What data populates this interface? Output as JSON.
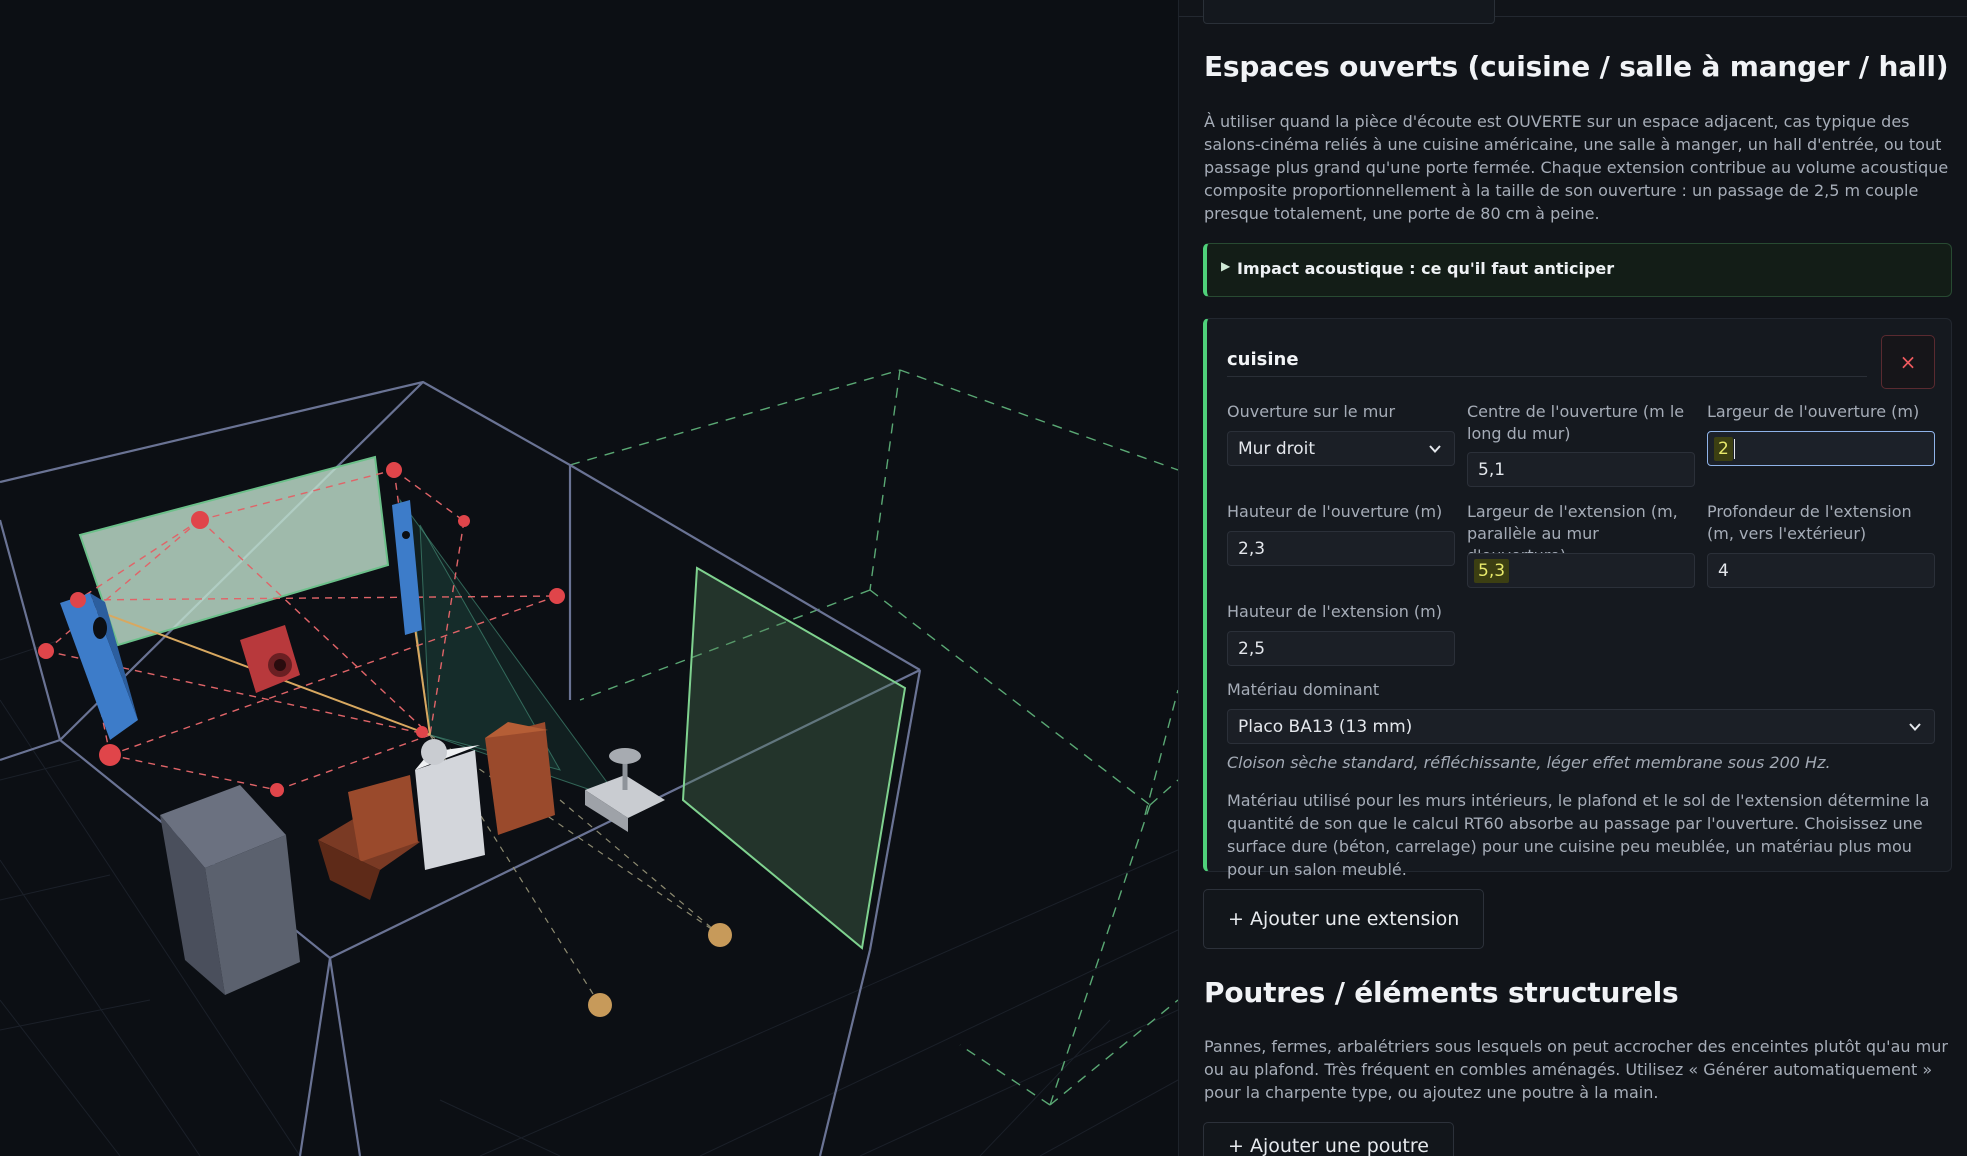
{
  "sections": {
    "open_spaces": {
      "title": "Espaces ouverts (cuisine / salle à manger / hall)",
      "description": "À utiliser quand la pièce d'écoute est OUVERTE sur un espace adjacent, cas typique des salons-cinéma reliés à une cuisine américaine, une salle à manger, un hall d'entrée, ou tout passage plus grand qu'une porte fermée. Chaque extension contribue au volume acoustique composite proportionnellement à la taille de son ouverture : un passage de 2,5 m couple presque totalement, une porte de 80 cm à peine.",
      "details_label": "Impact acoustique : ce qu'il faut anticiper",
      "add_extension_label": "+ Ajouter une extension"
    },
    "beams": {
      "title": "Poutres / éléments structurels",
      "description": "Pannes, fermes, arbalétriers sous lesquels on peut accrocher des enceintes plutôt qu'au mur ou au plafond. Très fréquent en combles aménagés. Utilisez « Générer automatiquement » pour la charpente type, ou ajoutez une poutre à la main.",
      "add_beam_label": "+ Ajouter une poutre"
    }
  },
  "extension": {
    "name": "cuisine",
    "remove_label": "×",
    "wall_label": "Ouverture sur le mur",
    "wall_value": "Mur droit",
    "center_label": "Centre de l'ouverture (m le long du mur)",
    "center_value": "5,1",
    "opening_width_label": "Largeur de l'ouverture (m)",
    "opening_width_value": "2",
    "opening_height_label": "Hauteur de l'ouverture (m)",
    "opening_height_value": "2,3",
    "ext_width_label": "Largeur de l'extension (m, parallèle au mur d'ouverture)",
    "ext_width_value": "5,3",
    "ext_depth_label": "Profondeur de l'extension (m, vers l'extérieur)",
    "ext_depth_value": "4",
    "ext_height_label": "Hauteur de l'extension (m)",
    "ext_height_value": "2,5",
    "material_label": "Matériau dominant",
    "material_value": "Placo BA13 (13 mm)",
    "material_note": "Cloison sèche standard, réfléchissante, léger effet membrane sous 200 Hz.",
    "material_help": "Matériau utilisé pour les murs intérieurs, le plafond et le sol de l'extension détermine la quantité de son que le calcul RT60 absorbe au passage par l'ouverture. Choisissez une surface dure (béton, carrelage) pour une cuisine peu meublée, un matériau plus mou pour un salon meublé."
  },
  "icons": {
    "details_marker": "triangle-right-icon",
    "select_caret": "chevron-down-icon",
    "remove": "close-icon"
  },
  "colors": {
    "accent_green": "#4fd17a",
    "danger_red": "#ef5a5f",
    "focus_blue": "#8fb3e8",
    "highlight_yellow": "#e8ea6b",
    "speaker_blue": "#3d7cc9",
    "sphere_red": "#e0454a"
  }
}
